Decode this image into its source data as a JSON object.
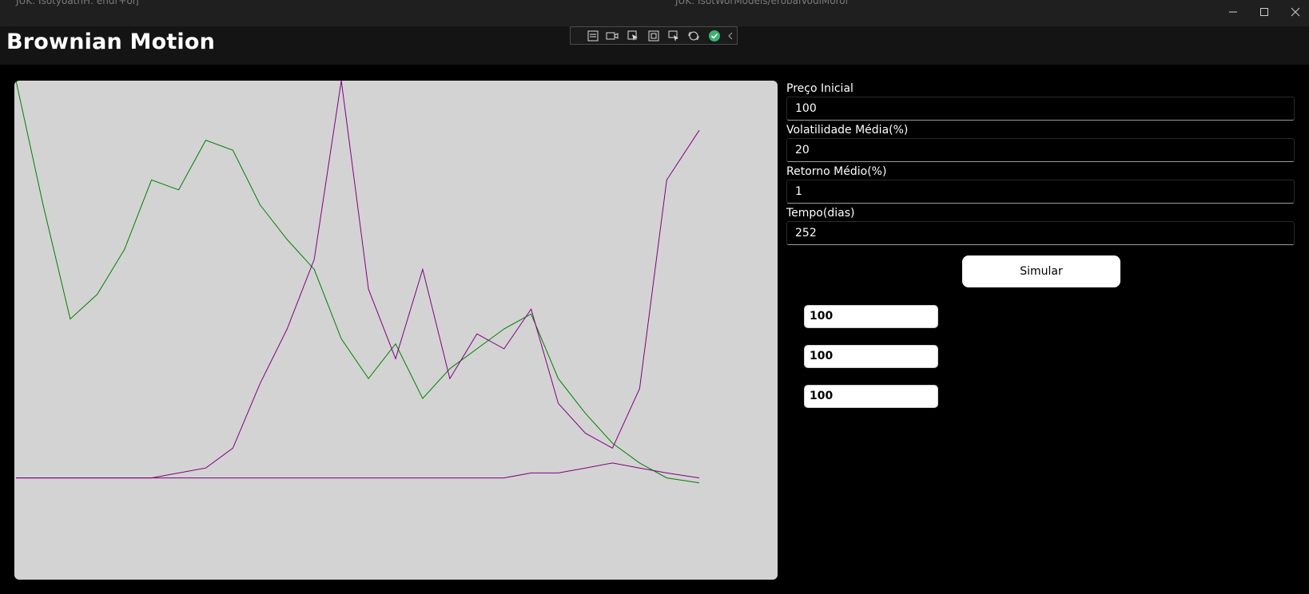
{
  "window": {
    "tab_left": "JUK: IsotyoathH:  endr+oi]",
    "tab_right": "JUK: IsotWorModels/erobalVodiMorol",
    "minimize_icon": "minimize-icon",
    "maximize_icon": "maximize-icon",
    "close_icon": "close-icon"
  },
  "app": {
    "title": "Brownian Motion"
  },
  "devtoolbar": {
    "icons": [
      "live-visual-tree-icon",
      "camera-icon",
      "select-element-icon",
      "display-layout-adorners-icon",
      "track-focus-icon",
      "hot-reload-icon",
      "check-circle-icon",
      "collapse-chevron-icon"
    ]
  },
  "form": {
    "preco": {
      "label": "Preço Inicial",
      "value": "100"
    },
    "volatilidade": {
      "label": "Volatilidade Média(%)",
      "value": "20"
    },
    "retorno": {
      "label": "Retorno Médio(%)",
      "value": "1"
    },
    "tempo": {
      "label": "Tempo(dias)",
      "value": "252"
    },
    "simular_label": "Simular"
  },
  "results": [
    "100",
    "100",
    "100"
  ],
  "colors": {
    "series_green": "#008000",
    "series_purple": "#800080",
    "chart_bg": "#d3d3d3",
    "window_bg": "#000000"
  },
  "chart_data": {
    "type": "line",
    "x": [
      0,
      10,
      20,
      30,
      40,
      50,
      60,
      70,
      80,
      90,
      100,
      110,
      120,
      130,
      140,
      150,
      160,
      170,
      180,
      190,
      200,
      210,
      220,
      230,
      240,
      252
    ],
    "series": [
      {
        "color": "#008000",
        "values": [
          100,
          75,
          52,
          57,
          66,
          80,
          78,
          88,
          86,
          75,
          68,
          62,
          48,
          40,
          47,
          36,
          42,
          46,
          50,
          53,
          40,
          33,
          27,
          23,
          20,
          19
        ]
      },
      {
        "color": "#800080",
        "values": [
          20,
          20,
          20,
          20,
          20,
          20,
          21,
          22,
          26,
          39,
          50,
          64,
          100,
          58,
          44,
          62,
          40,
          49,
          46,
          54,
          35,
          29,
          26,
          38,
          80,
          90
        ]
      },
      {
        "color": "#800080",
        "values": [
          20,
          20,
          20,
          20,
          20,
          20,
          20,
          20,
          20,
          20,
          20,
          20,
          20,
          20,
          20,
          20,
          20,
          20,
          20,
          21,
          21,
          22,
          23,
          22,
          21,
          20
        ]
      }
    ]
  }
}
